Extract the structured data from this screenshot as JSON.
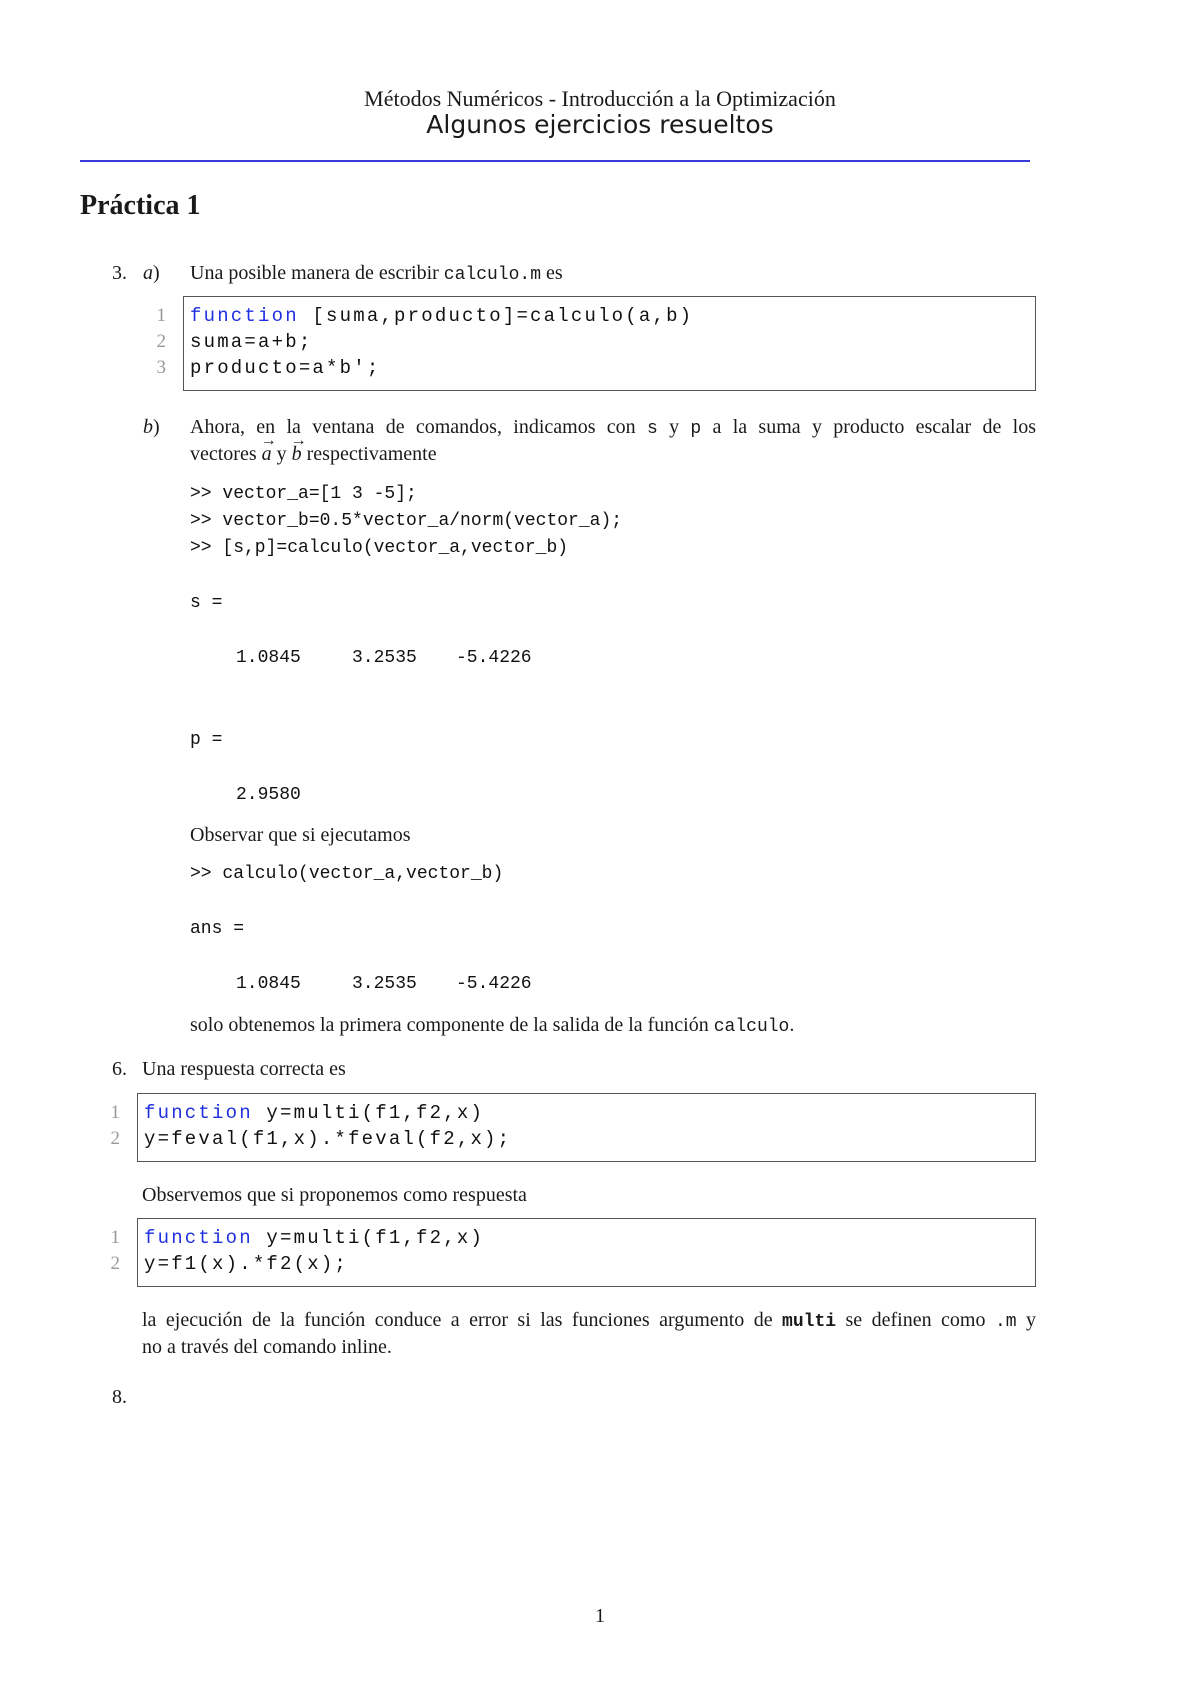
{
  "header": {
    "subtitle": "Métodos Numéricos - Introducción a la Optimización",
    "title": "Algunos ejercicios resueltos",
    "rule_color": "#3b3bdc"
  },
  "section": {
    "title": "Práctica 1"
  },
  "exercise3": {
    "number": "3.",
    "part_a": {
      "label": "a",
      "text_before": "Una posible manera de escribir ",
      "code_name": "calculo.m",
      "text_after": " es",
      "code": [
        {
          "line": "1",
          "keyword": "function",
          "rest": " [suma,producto]=calculo(a,b)"
        },
        {
          "line": "2",
          "keyword": "",
          "rest": "suma=a+b;"
        },
        {
          "line": "3",
          "keyword": "",
          "rest": "producto=a*b';"
        }
      ]
    },
    "part_b": {
      "label": "b",
      "line1_a": "Ahora, en la ventana de comandos, indicamos con ",
      "s": "s",
      "y1": " y ",
      "p": "p",
      "line1_b": " a la suma y producto escalar de los",
      "line2_a": "vectores ",
      "vec_a": "a",
      "y2": " y ",
      "vec_b": "b",
      "line2_b": " respectivamente",
      "commands": [
        ">> vector_a=[1 3 -5];",
        ">> vector_b=0.5*vector_a/norm(vector_a);",
        ">> [s,p]=calculo(vector_a,vector_b)"
      ],
      "s_label": "s =",
      "s_values": [
        "1.0845",
        "3.2535",
        "-5.4226"
      ],
      "p_label": "p =",
      "p_value": "2.9580",
      "observe_text": "Observar que si ejecutamos",
      "command2": ">> calculo(vector_a,vector_b)",
      "ans_label": "ans =",
      "ans_values": [
        "1.0845",
        "3.2535",
        "-5.4226"
      ],
      "conclusion_a": "solo obtenemos la primera componente de la salida de la función ",
      "conclusion_code": "calculo",
      "conclusion_b": "."
    }
  },
  "exercise6": {
    "number": "6.",
    "intro": "Una respuesta correcta es",
    "code1": [
      {
        "line": "1",
        "keyword": "function",
        "rest": " y=multi(f1,f2,x)"
      },
      {
        "line": "2",
        "keyword": "",
        "rest": "y=feval(f1,x).*feval(f2,x);"
      }
    ],
    "observe": "Observemos que si proponemos como respuesta",
    "code2": [
      {
        "line": "1",
        "keyword": "function",
        "rest": " y=multi(f1,f2,x)"
      },
      {
        "line": "2",
        "keyword": "",
        "rest": "y=f1(x).*f2(x);"
      }
    ],
    "note_a": "la ejecución de la función conduce a error si las funciones argumento de ",
    "note_code1": "multi",
    "note_b": " se definen como ",
    "note_code2": ".m",
    "note_c": " y",
    "note_line2": "no a través del comando inline."
  },
  "exercise8": {
    "number": "8."
  },
  "footer": {
    "page_number": "1"
  }
}
